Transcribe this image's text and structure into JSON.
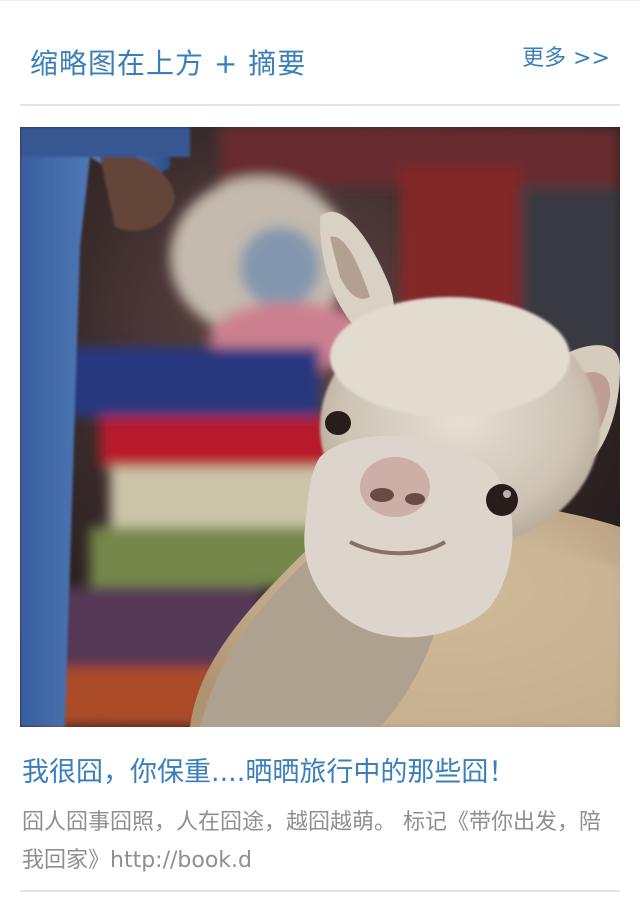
{
  "header": {
    "title": "缩略图在上方 + 摘要",
    "more_label": "更多 >>"
  },
  "article": {
    "title": "我很囧，你保重....晒晒旅行中的那些囧！",
    "summary": "囧人囧事囧照，人在囧途，越囧越萌。 标记《带你出发，陪我回家》http://book.d",
    "image_alt": "alpaca photo thumbnail"
  },
  "colors": {
    "accent": "#3a7fba",
    "summary_text": "#8f8f8f",
    "divider": "#e3e3e3"
  }
}
